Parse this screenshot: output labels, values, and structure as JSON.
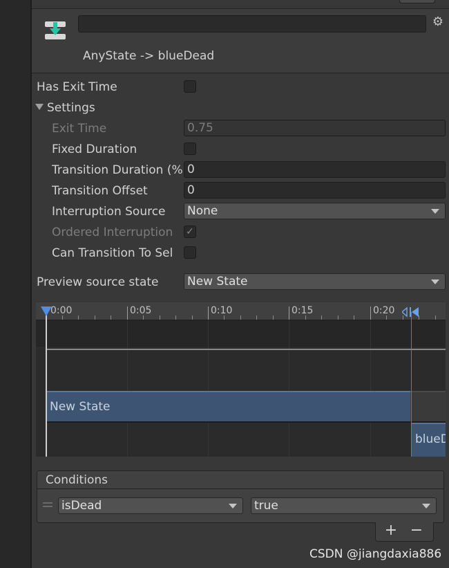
{
  "transition": {
    "name_value": "",
    "title": "AnyState -> blueDead"
  },
  "settings": {
    "has_exit_time_label": "Has Exit Time",
    "has_exit_time_checked": false,
    "section_label": "Settings",
    "exit_time_label": "Exit Time",
    "exit_time_value": "0.75",
    "fixed_duration_label": "Fixed Duration",
    "fixed_duration_checked": false,
    "transition_duration_label": "Transition Duration (%",
    "transition_duration_value": "0",
    "transition_offset_label": "Transition Offset",
    "transition_offset_value": "0",
    "interruption_source_label": "Interruption Source",
    "interruption_source_value": "None",
    "ordered_interruption_label": "Ordered Interruption",
    "ordered_interruption_checked": true,
    "can_transition_to_self_label": "Can Transition To Sel",
    "can_transition_to_self_checked": false
  },
  "preview": {
    "label": "Preview source state",
    "value": "New State"
  },
  "timeline": {
    "ticks": [
      "0:00",
      "0:05",
      "0:10",
      "0:15",
      "0:20"
    ],
    "source_state": "New State",
    "destination_state": "blueDead"
  },
  "conditions": {
    "title": "Conditions",
    "parameter": "isDead",
    "value": "true",
    "add_label": "+",
    "remove_label": "−"
  },
  "watermark": "CSDN @jiangdaxia886",
  "icons": {
    "transition": "transition-arrow-icon",
    "settings": "gear-icon",
    "fold": "foldout-triangle-icon",
    "playhead": "playhead-marker-icon",
    "transition_end": "transition-end-marker-icon"
  },
  "colors": {
    "state_bar": "#3d5473",
    "icon_accent": "#2dc2a8",
    "background": "#383838"
  }
}
